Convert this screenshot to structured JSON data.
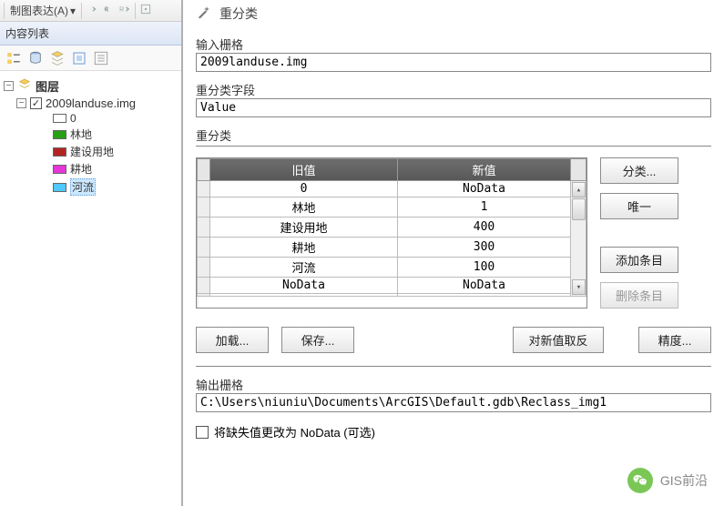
{
  "menu": {
    "cartographic": "制图表达(A)"
  },
  "toc_title": "内容列表",
  "tree": {
    "root": "图层",
    "layer": "2009landuse.img",
    "classes": [
      {
        "label": "0",
        "color": "#ffffff"
      },
      {
        "label": "林地",
        "color": "#28a015"
      },
      {
        "label": "建设用地",
        "color": "#b22424"
      },
      {
        "label": "耕地",
        "color": "#e536d7"
      },
      {
        "label": "河流",
        "color": "#4fc8ff"
      }
    ]
  },
  "dialog": {
    "title": "重分类",
    "input_raster_label": "输入栅格",
    "input_raster_value": "2009landuse.img",
    "reclass_field_label": "重分类字段",
    "reclass_field_value": "Value",
    "reclass_section_label": "重分类",
    "columns": {
      "old": "旧值",
      "new": "新值"
    },
    "rows": [
      {
        "old": "0",
        "new": "NoData"
      },
      {
        "old": "林地",
        "new": "1"
      },
      {
        "old": "建设用地",
        "new": "400"
      },
      {
        "old": "耕地",
        "new": "300"
      },
      {
        "old": "河流",
        "new": "100"
      },
      {
        "old": "NoData",
        "new": "NoData"
      }
    ],
    "buttons": {
      "classify": "分类...",
      "unique": "唯一",
      "add_entry": "添加条目",
      "delete_entry": "删除条目",
      "load": "加载...",
      "save": "保存...",
      "reverse": "对新值取反",
      "precision": "精度..."
    },
    "output_raster_label": "输出栅格",
    "output_raster_value": "C:\\Users\\niuniu\\Documents\\ArcGIS\\Default.gdb\\Reclass_img1",
    "missing_nodata": "将缺失值更改为 NoData (可选)"
  },
  "watermark": "GIS前沿"
}
